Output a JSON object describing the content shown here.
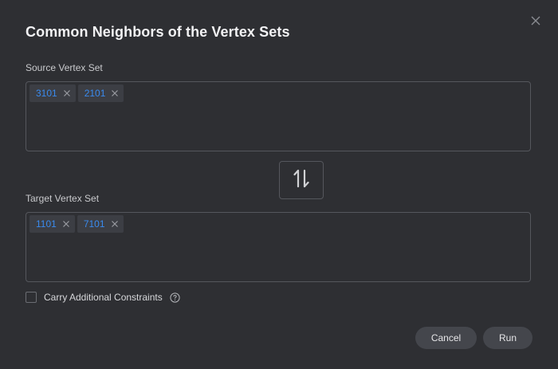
{
  "dialog": {
    "title": "Common Neighbors of the Vertex Sets",
    "close_icon": "close-icon"
  },
  "source": {
    "label": "Source Vertex Set",
    "tags": [
      "3101",
      "2101"
    ]
  },
  "swap": {
    "icon": "swap-vertical-icon"
  },
  "target": {
    "label": "Target Vertex Set",
    "tags": [
      "1101",
      "7101"
    ]
  },
  "constraints": {
    "label": "Carry Additional Constraints",
    "checked": false,
    "help_icon": "question-circle-icon"
  },
  "footer": {
    "cancel_label": "Cancel",
    "run_label": "Run"
  },
  "colors": {
    "background": "#2e2f33",
    "tag_background": "#3c3e44",
    "tag_text": "#3a8bef",
    "button_background": "#44464c",
    "border": "#55575d"
  }
}
